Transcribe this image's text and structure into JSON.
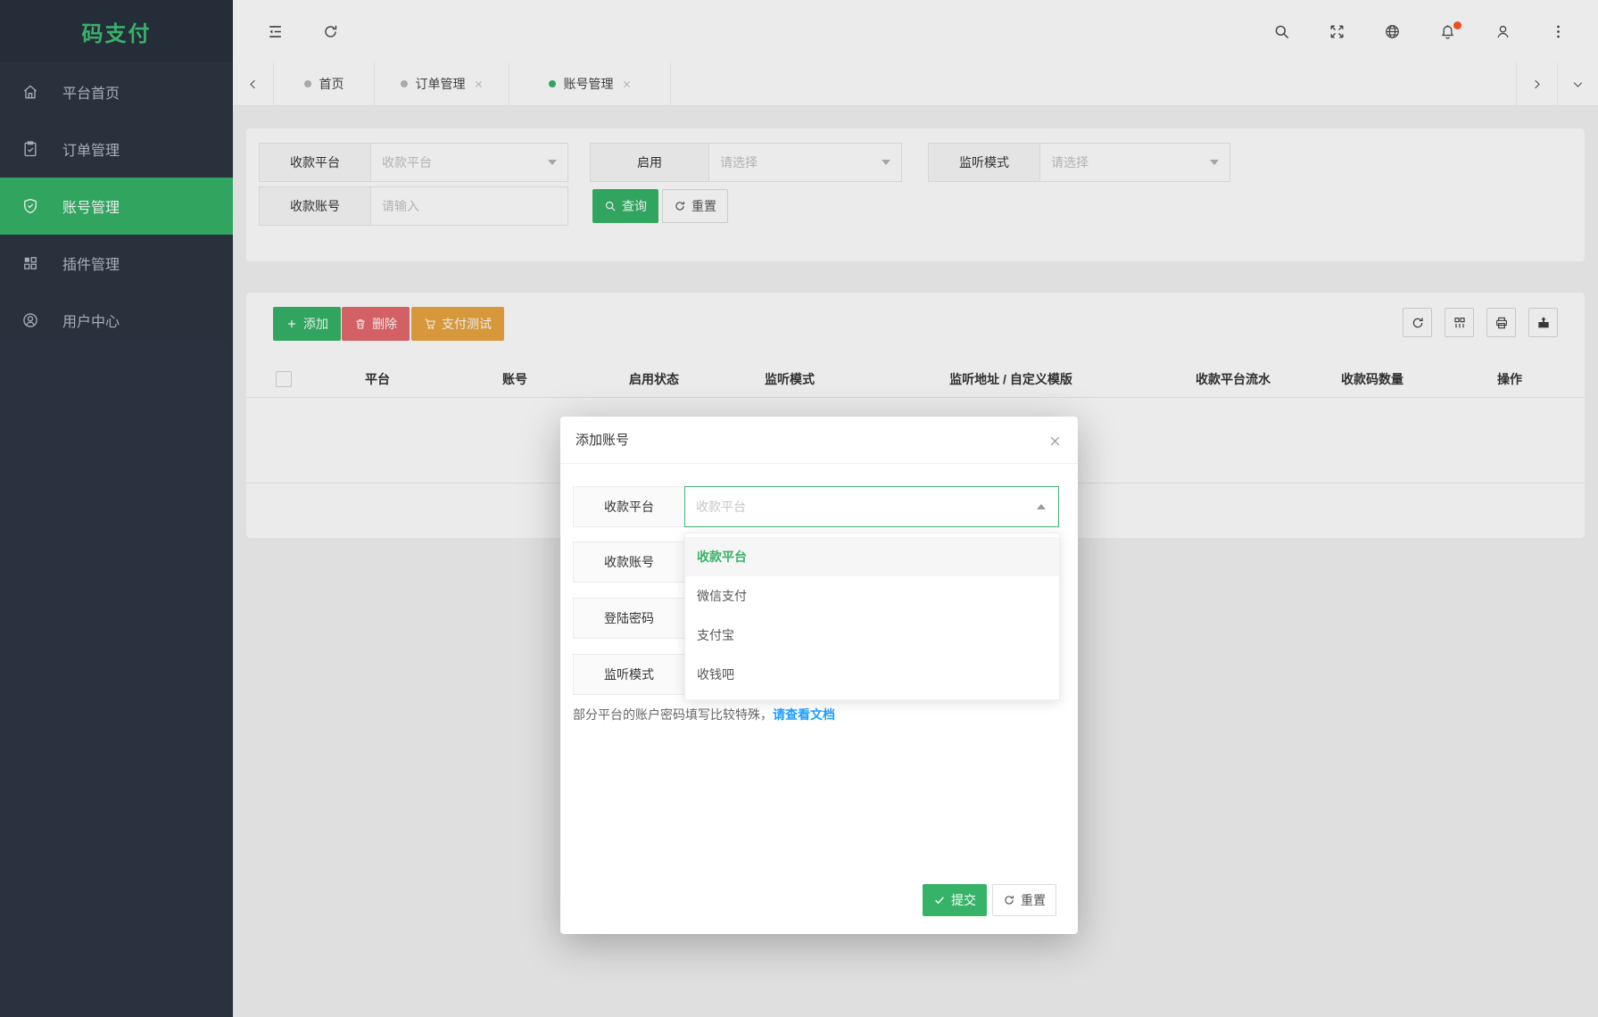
{
  "app": {
    "title": "码支付"
  },
  "sidebar": {
    "items": [
      {
        "label": "平台首页"
      },
      {
        "label": "订单管理"
      },
      {
        "label": "账号管理"
      },
      {
        "label": "插件管理"
      },
      {
        "label": "用户中心"
      }
    ],
    "active_index": 2
  },
  "tabbar": {
    "tabs": [
      {
        "label": "首页",
        "active": false,
        "closable": false
      },
      {
        "label": "订单管理",
        "active": false,
        "closable": true
      },
      {
        "label": "账号管理",
        "active": true,
        "closable": true
      }
    ]
  },
  "filter": {
    "platform_label": "收款平台",
    "platform_placeholder": "收款平台",
    "enabled_label": "启用",
    "enabled_placeholder": "请选择",
    "listen_label": "监听模式",
    "listen_placeholder": "请选择",
    "account_label": "收款账号",
    "account_placeholder": "请输入",
    "search_label": "查询",
    "reset_label": "重置"
  },
  "toolbar": {
    "add_label": "添加",
    "delete_label": "删除",
    "pay_test_label": "支付测试"
  },
  "table": {
    "columns": [
      "平台",
      "账号",
      "启用状态",
      "监听模式",
      "监听地址 / 自定义模版",
      "收款平台流水",
      "收款码数量",
      "操作"
    ]
  },
  "modal": {
    "title": "添加账号",
    "fields": [
      {
        "label": "收款平台",
        "placeholder": "收款平台"
      },
      {
        "label": "收款账号"
      },
      {
        "label": "登陆密码"
      },
      {
        "label": "监听模式"
      }
    ],
    "dropdown_options": [
      {
        "label": "收款平台",
        "selected": true
      },
      {
        "label": "微信支付",
        "selected": false
      },
      {
        "label": "支付宝",
        "selected": false
      },
      {
        "label": "收钱吧",
        "selected": false
      }
    ],
    "note": "部分平台的账户密码填写比较特殊，",
    "note_link": "请查看文档",
    "submit_label": "提交",
    "reset_label": "重置"
  },
  "colors": {
    "primary_green": "#36b368",
    "danger_red": "#e5696d",
    "warning_orange": "#eaa542",
    "link_blue": "#1e9fff",
    "notification_badge": "#ff5722"
  }
}
